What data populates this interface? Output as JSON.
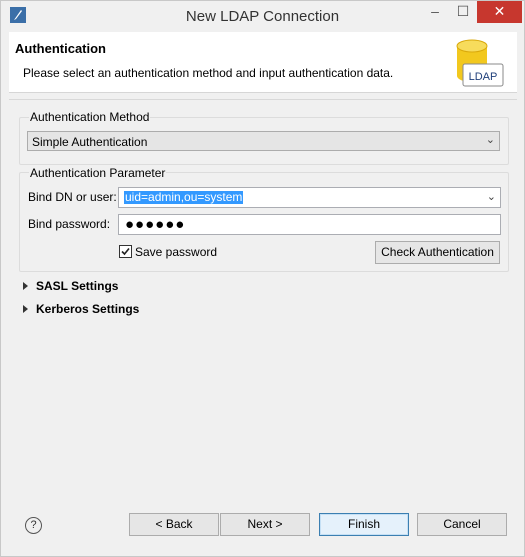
{
  "window": {
    "title": "New LDAP Connection"
  },
  "titlebar": {
    "minimize": "–",
    "maximize": "☐",
    "close": "✕"
  },
  "banner": {
    "title": "Authentication",
    "description": "Please select an authentication method and input authentication data.",
    "icon_label": "LDAP"
  },
  "auth_method": {
    "group_label": "Authentication Method",
    "selected": "Simple Authentication"
  },
  "auth_param": {
    "group_label": "Authentication Parameter",
    "bind_dn_label": "Bind DN or user:",
    "bind_dn_value": "uid=admin,ou=system",
    "bind_password_label": "Bind password:",
    "bind_password_value": "●●●●●●",
    "save_password_label": "Save password",
    "save_password_checked": true,
    "check_button": "Check Authentication"
  },
  "sections": {
    "sasl": "SASL Settings",
    "kerberos": "Kerberos Settings"
  },
  "footer": {
    "help": "?",
    "back": "< Back",
    "next": "Next >",
    "finish": "Finish",
    "cancel": "Cancel"
  },
  "colors": {
    "selection": "#3399ff",
    "close_button": "#c7372e"
  }
}
